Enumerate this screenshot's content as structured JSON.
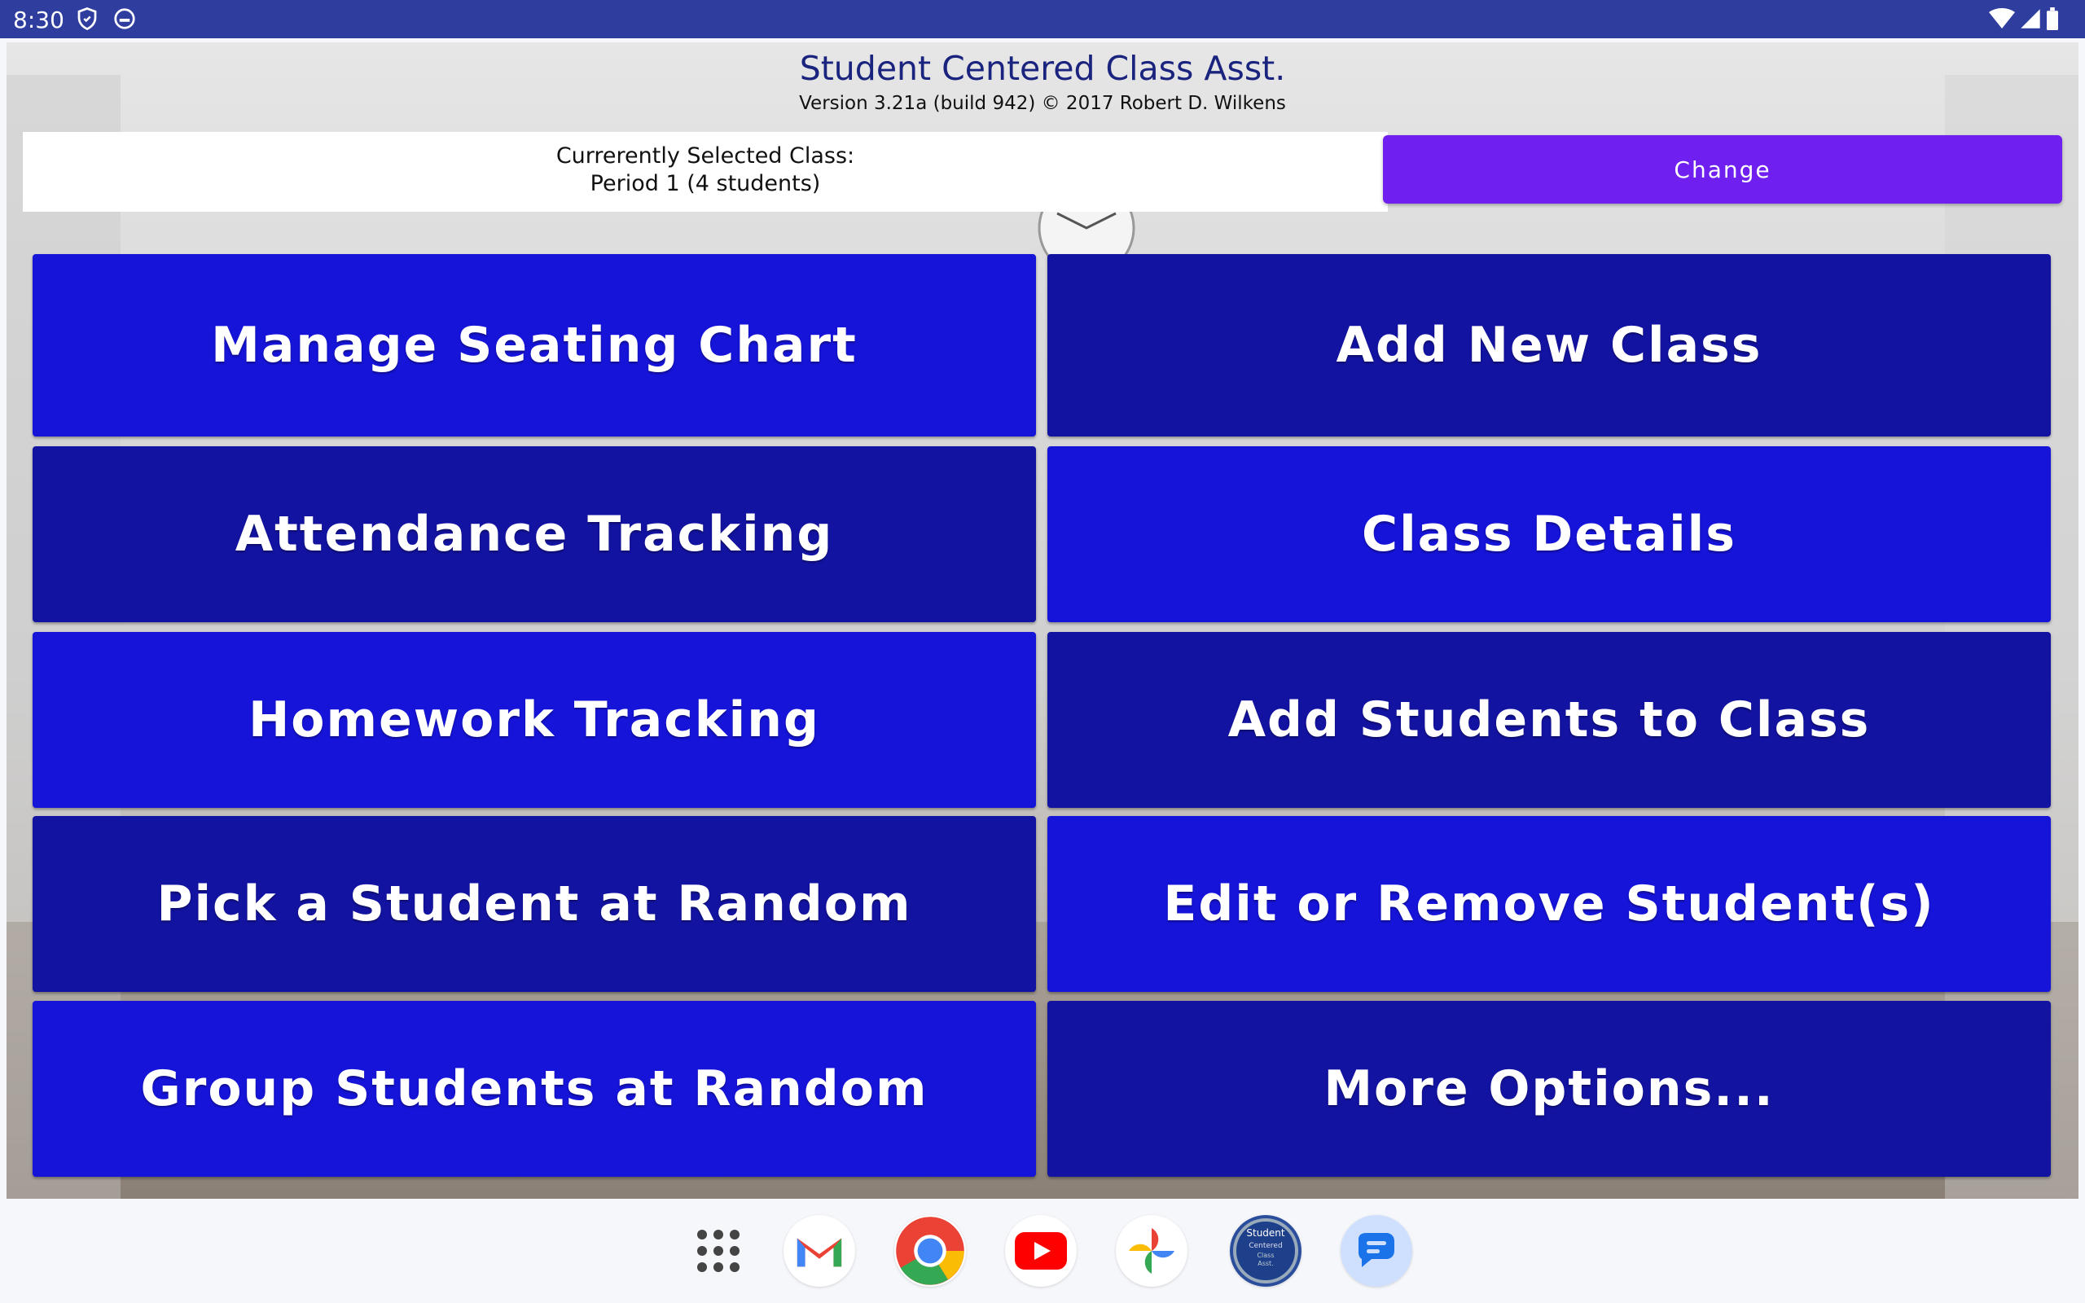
{
  "status_bar": {
    "time": "8:30"
  },
  "app": {
    "title": "Student Centered Class Asst.",
    "version": "Version 3.21a (build 942) © 2017 Robert D. Wilkens",
    "selected_class_label": "Currerently Selected Class:",
    "selected_class_value": "Period 1 (4 students)",
    "change_label": "Change",
    "buttons": [
      "Manage Seating Chart",
      "Add New Class",
      "Attendance Tracking",
      "Class Details",
      "Homework Tracking",
      "Add Students to Class",
      "Pick a Student at Random",
      "Edit or Remove Student(s)",
      "Group Students at Random",
      "More Options..."
    ],
    "colors": {
      "bright_button": "#1614d8",
      "dark_button": "#1313a2",
      "change_button": "#6f1ff0",
      "status_bar": "#2f3e9e"
    }
  },
  "dock": {
    "apps": [
      "app-drawer-icon",
      "gmail-icon",
      "chrome-icon",
      "youtube-icon",
      "photos-icon",
      "student-centered-app-icon",
      "messages-icon"
    ],
    "app_icon_text": "Student Centered Class Asst."
  }
}
